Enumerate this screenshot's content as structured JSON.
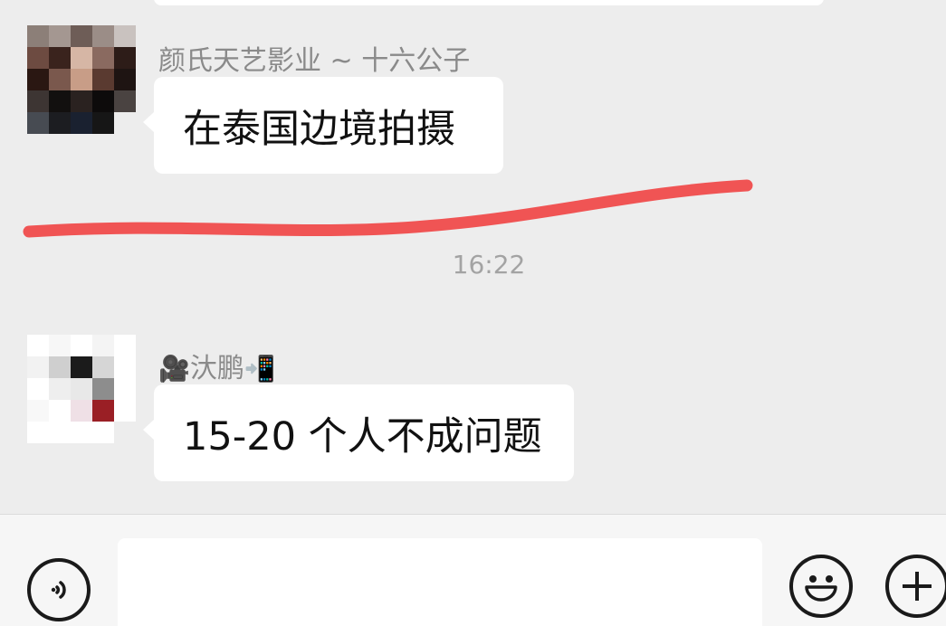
{
  "messages": [
    {
      "sender": "颜氏天艺影业 ~ 十六公子",
      "text": "在泰国边境拍摄"
    },
    {
      "sender_emoji_prefix": "🎥",
      "sender_name": "汏鹏",
      "sender_emoji_suffix": "📲",
      "text": "15-20 个人不成问题"
    }
  ],
  "timestamp": "16:22",
  "input_bar": {
    "input_value": "",
    "voice_icon": "voice-icon",
    "emoji_icon": "emoji-icon",
    "plus_icon": "plus-icon"
  },
  "colors": {
    "background": "#ededed",
    "bubble": "#ffffff",
    "annotation_stroke": "#f05454",
    "sender_text": "#8a8a8a",
    "timestamp_text": "#a3a3a3"
  }
}
